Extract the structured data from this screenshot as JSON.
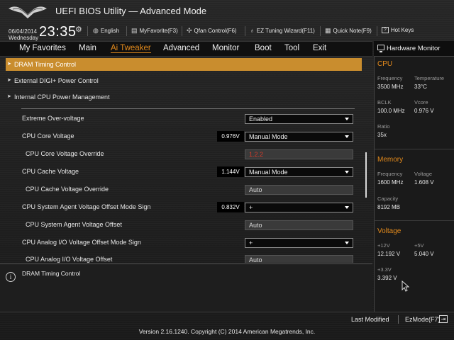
{
  "header": {
    "title": "UEFI BIOS Utility — Advanced Mode",
    "date": "06/04/2014",
    "weekday": "Wednesday",
    "time": "23:35",
    "tools": [
      {
        "label": "English",
        "icon": "globe-icon"
      },
      {
        "label": "MyFavorite(F3)",
        "icon": "favorite-icon"
      },
      {
        "label": "Qfan Control(F6)",
        "icon": "fan-icon"
      },
      {
        "label": "EZ Tuning Wizard(F11)",
        "icon": "bulb-icon"
      },
      {
        "label": "Quick Note(F9)",
        "icon": "note-icon"
      },
      {
        "label": "Hot Keys",
        "icon": "help-icon"
      }
    ]
  },
  "menu": {
    "items": [
      "My Favorites",
      "Main",
      "Ai Tweaker",
      "Advanced",
      "Monitor",
      "Boot",
      "Tool",
      "Exit"
    ],
    "active": "Ai Tweaker"
  },
  "submenus": [
    {
      "label": "DRAM Timing Control",
      "highlighted": true
    },
    {
      "label": "External DIGI+ Power Control",
      "highlighted": false
    },
    {
      "label": "Internal CPU Power Management",
      "highlighted": false
    }
  ],
  "settings": [
    {
      "label": "Extreme Over-voltage",
      "reading": "",
      "value": "Enabled",
      "kind": "dropdown"
    },
    {
      "label": "CPU Core Voltage",
      "reading": "0.976V",
      "value": "Manual Mode",
      "kind": "dropdown"
    },
    {
      "label": "CPU Core Voltage Override",
      "reading": "",
      "value": "1.2.2",
      "kind": "readonly-red"
    },
    {
      "label": "CPU Cache Voltage",
      "reading": "1.144V",
      "value": "Manual Mode",
      "kind": "dropdown"
    },
    {
      "label": "CPU Cache Voltage Override",
      "reading": "",
      "value": "Auto",
      "kind": "readonly"
    },
    {
      "label": "CPU System Agent Voltage Offset Mode Sign",
      "reading": "0.832V",
      "value": "+",
      "kind": "dropdown"
    },
    {
      "label": "CPU System Agent Voltage Offset",
      "reading": "",
      "value": "Auto",
      "kind": "readonly"
    },
    {
      "label": "CPU Analog I/O Voltage Offset Mode Sign",
      "reading": "",
      "value": "+",
      "kind": "dropdown"
    },
    {
      "label": "CPU Analog I/O Voltage Offset",
      "reading": "",
      "value": "Auto",
      "kind": "readonly"
    }
  ],
  "help_text": "DRAM Timing Control",
  "hardware_monitor": {
    "title": "Hardware Monitor",
    "cpu": {
      "title": "CPU",
      "frequency_label": "Frequency",
      "frequency": "3500 MHz",
      "temperature_label": "Temperature",
      "temperature": "33°C",
      "bclk_label": "BCLK",
      "bclk": "100.0 MHz",
      "vcore_label": "Vcore",
      "vcore": "0.976 V",
      "ratio_label": "Ratio",
      "ratio": "35x"
    },
    "memory": {
      "title": "Memory",
      "frequency_label": "Frequency",
      "frequency": "1600 MHz",
      "voltage_label": "Voltage",
      "voltage": "1.608 V",
      "capacity_label": "Capacity",
      "capacity": "8192 MB"
    },
    "voltage": {
      "title": "Voltage",
      "v12_label": "+12V",
      "v12": "12.192 V",
      "v5_label": "+5V",
      "v5": "5.040 V",
      "v33_label": "+3.3V",
      "v33": "3.392 V"
    }
  },
  "footer": {
    "last_modified": "Last Modified",
    "ez_mode": "EzMode(F7)",
    "version": "Version 2.16.1240. Copyright (C) 2014 American Megatrends, Inc."
  },
  "colors": {
    "accent": "#e38a1c",
    "highlight": "#c98d2e",
    "value_red": "#d43a2a"
  }
}
